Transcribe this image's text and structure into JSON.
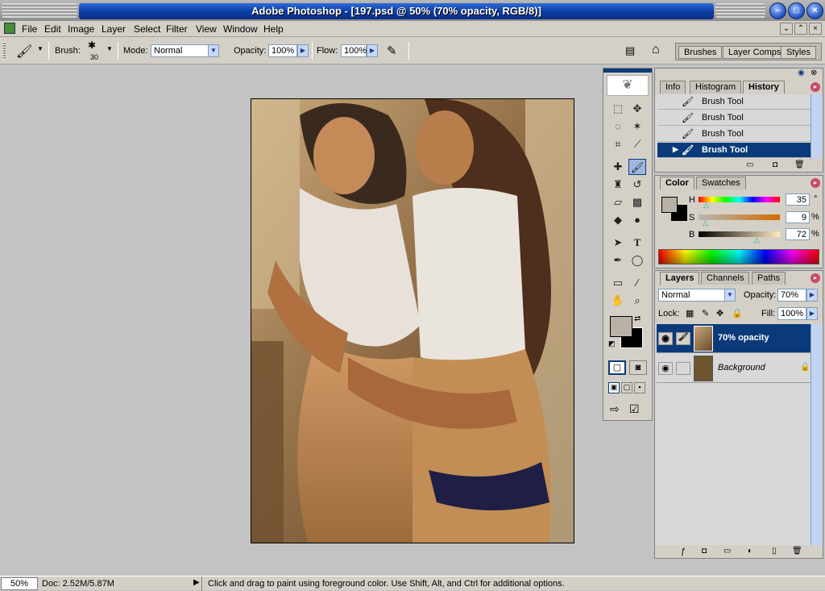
{
  "window": {
    "title": "Adobe Photoshop - [197.psd @ 50% (70% opacity, RGB/8)]"
  },
  "menu": [
    "File",
    "Edit",
    "Image",
    "Layer",
    "Select",
    "Filter",
    "View",
    "Window",
    "Help"
  ],
  "options": {
    "brush_label": "Brush:",
    "brush_size": "30",
    "mode_label": "Mode:",
    "mode_value": "Normal",
    "opacity_label": "Opacity:",
    "opacity_value": "100%",
    "flow_label": "Flow:",
    "flow_value": "100%",
    "well_tabs": [
      "Brushes",
      "Layer Comps",
      "Styles"
    ]
  },
  "history_panel": {
    "tabs": [
      "Info",
      "Histogram",
      "History"
    ],
    "items": [
      "Brush Tool",
      "Brush Tool",
      "Brush Tool",
      "Brush Tool"
    ]
  },
  "color_panel": {
    "tabs": [
      "Color",
      "Swatches"
    ],
    "h_label": "H",
    "h_value": "35",
    "h_unit": "°",
    "s_label": "S",
    "s_value": "9",
    "s_unit": "%",
    "b_label": "B",
    "b_value": "72",
    "b_unit": "%",
    "h_fraction": 0.1,
    "s_fraction": 0.09,
    "b_fraction": 0.72,
    "foreground": "#b9b1a6",
    "background": "#000000"
  },
  "layers_panel": {
    "tabs": [
      "Layers",
      "Channels",
      "Paths"
    ],
    "blend_mode": "Normal",
    "opacity_label": "Opacity:",
    "opacity_value": "70%",
    "lock_label": "Lock:",
    "fill_label": "Fill:",
    "fill_value": "100%",
    "layers": [
      {
        "name": "70% opacity",
        "selected": true
      },
      {
        "name": "Background",
        "selected": false
      }
    ]
  },
  "status": {
    "zoom": "50%",
    "doc": "Doc: 2.52M/5.87M",
    "hint": "Click and drag to paint using foreground color.  Use Shift, Alt, and Ctrl for additional options."
  },
  "colors": {
    "accent": "#0a3a7a",
    "titlebar": "#0d3fa8"
  }
}
